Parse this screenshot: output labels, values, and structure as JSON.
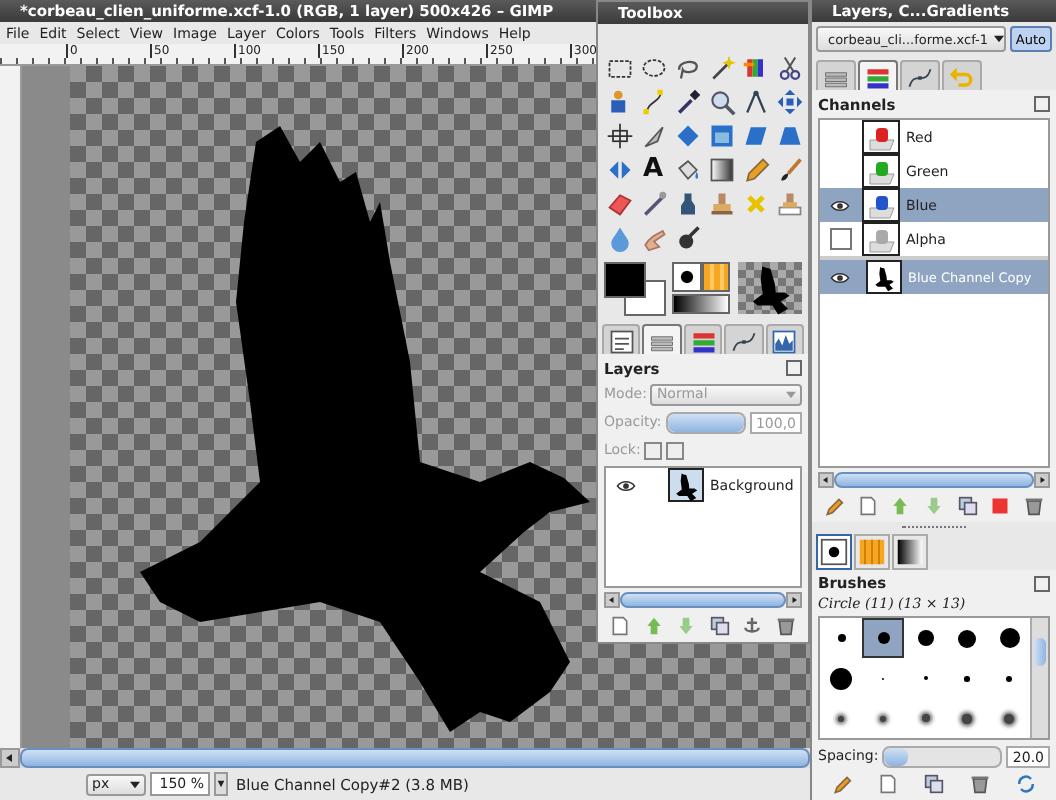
{
  "image_window": {
    "title": "*corbeau_clien_uniforme.xcf-1.0 (RGB, 1 layer) 500x426 – GIMP",
    "menu": [
      "File",
      "Edit",
      "Select",
      "View",
      "Image",
      "Layer",
      "Colors",
      "Tools",
      "Filters",
      "Windows",
      "Help"
    ],
    "ruler_labels": [
      "0",
      "50",
      "100",
      "150",
      "200",
      "250",
      "300"
    ],
    "status_bar": {
      "unit": "px",
      "zoom": "150 %",
      "message": "Blue Channel Copy#2 (3.8 MB)"
    }
  },
  "toolbox": {
    "title": "Toolbox",
    "text_tool_glyph": "A",
    "tabs": [
      {
        "kind": "options",
        "selected": false
      },
      {
        "kind": "layers",
        "selected": true
      },
      {
        "kind": "channels",
        "selected": false
      },
      {
        "kind": "paths",
        "selected": false
      },
      {
        "kind": "histogram",
        "selected": false
      }
    ],
    "layers": {
      "title": "Layers",
      "mode_label": "Mode:",
      "mode": "Normal",
      "opacity_label": "Opacity:",
      "opacity": "100,0",
      "level": 1.0,
      "lock_label": "Lock:",
      "locks": [
        {
          "checked": false
        },
        {
          "checked": false
        }
      ],
      "disabled": true,
      "items": [
        {
          "name": "Background",
          "visible": true,
          "selected": false
        }
      ]
    }
  },
  "dock": {
    "title": "Layers, C...Gradients",
    "image_menu": "corbeau_cli...forme.xcf-1",
    "auto_button": "Auto",
    "tabs": [
      {
        "kind": "layers",
        "selected": false
      },
      {
        "kind": "channels",
        "selected": true
      },
      {
        "kind": "paths",
        "selected": false
      },
      {
        "kind": "undo",
        "selected": false
      }
    ],
    "channels_title": "Channels",
    "channels": [
      {
        "name": "Red",
        "color": "#dd2222",
        "visible": false,
        "focused": false,
        "selected": false
      },
      {
        "name": "Green",
        "color": "#22aa22",
        "visible": false,
        "focused": false,
        "selected": false
      },
      {
        "name": "Blue",
        "color": "#2255cc",
        "visible": true,
        "focused": false,
        "selected": true
      },
      {
        "name": "Alpha",
        "color": "#aaaaaa",
        "visible": false,
        "focused": true,
        "selected": false
      }
    ],
    "channel_copies": [
      {
        "name": "Blue Channel Copy",
        "visible": true,
        "selected": true
      }
    ],
    "brush_tabs": [
      {
        "kind": "brushes",
        "selected": true
      },
      {
        "kind": "patterns",
        "selected": false
      },
      {
        "kind": "gradients",
        "selected": false
      }
    ],
    "brushes_title": "Brushes",
    "brush_name": "Circle (11) (13 × 13)",
    "brushes": [
      {
        "kind": "hard",
        "selected": false
      },
      {
        "kind": "hard",
        "selected": true
      },
      {
        "kind": "hard",
        "selected": false
      },
      {
        "kind": "hard",
        "selected": false
      },
      {
        "kind": "hard",
        "selected": false
      },
      {
        "kind": "hard",
        "selected": false
      },
      {
        "kind": "hard",
        "selected": false
      },
      {
        "kind": "hard",
        "selected": false
      },
      {
        "kind": "hard",
        "selected": false
      },
      {
        "kind": "hard",
        "selected": false
      },
      {
        "kind": "soft",
        "selected": false
      },
      {
        "kind": "soft",
        "selected": false
      },
      {
        "kind": "soft",
        "selected": false
      },
      {
        "kind": "soft",
        "selected": false
      },
      {
        "kind": "soft",
        "selected": false
      }
    ],
    "spacing_label": "Spacing:",
    "spacing": "20.0",
    "level": 0.2
  }
}
